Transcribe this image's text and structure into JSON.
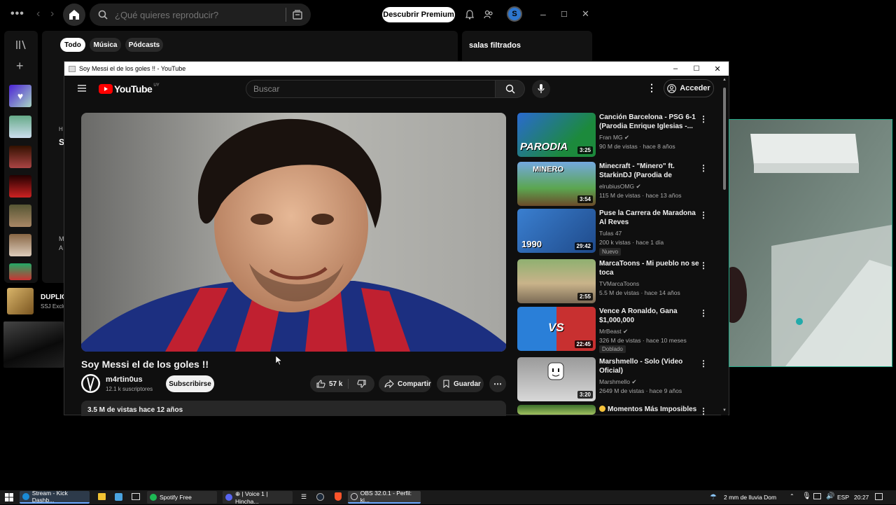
{
  "spotify": {
    "search_placeholder": "¿Qué quieres reproducir?",
    "premium_label": "Descubrir Premium",
    "avatar_letter": "S",
    "chips": [
      "Todo",
      "Música",
      "Pódcasts"
    ],
    "right_panel_title": "salas filtrados",
    "now_playing_title": "DUPLIC",
    "now_playing_artist": "SSJ Exclu",
    "fragments": [
      "H",
      "S",
      "M",
      "A"
    ]
  },
  "youtube": {
    "window_title": "Soy Messi el de los goles !! - YouTube",
    "logo_text": "YouTube",
    "logo_region": "UY",
    "search_placeholder": "Buscar",
    "login_label": "Acceder",
    "video_title": "Soy Messi el de los goles !!",
    "channel_name": "m4rtin0us",
    "subscribers": "12.1 k suscriptores",
    "subscribe_label": "Subscribirse",
    "likes": "57 k",
    "share_label": "Compartir",
    "save_label": "Guardar",
    "views_date": "3.5 M de vistas  hace 12 años",
    "recommendations": [
      {
        "title": "Canción Barcelona - PSG 6-1 (Parodia Enrique Iglesias -...",
        "channel": "Fran MG",
        "verified": true,
        "meta": "90 M de vistas · hace 8 años",
        "duration": "3:25",
        "thumb_text": "PARODIA",
        "badge": ""
      },
      {
        "title": "Minecraft - \"Minero\" ft. StarkinDJ (Parodia de \"Torero\"...",
        "channel": "elrubiusOMG",
        "verified": true,
        "meta": "115 M de vistas · hace 13 años",
        "duration": "3:54",
        "thumb_text": "MINERO",
        "badge": ""
      },
      {
        "title": "Puse la Carrera de Maradona Al Reves",
        "channel": "Tulas 47",
        "verified": false,
        "meta": "200 k vistas · hace 1 día",
        "duration": "29:42",
        "thumb_text": "1990",
        "badge": "Nuevo"
      },
      {
        "title": "MarcaToons - Mi pueblo no se toca",
        "channel": "TVMarcaToons",
        "verified": false,
        "meta": "5.5 M de vistas · hace 14 años",
        "duration": "2:55",
        "thumb_text": "",
        "badge": ""
      },
      {
        "title": "Vence A Ronaldo, Gana $1,000,000",
        "channel": "MrBeast",
        "verified": true,
        "meta": "326 M de vistas · hace 10 meses",
        "duration": "22:45",
        "thumb_text": "VS",
        "badge": "Doblado"
      },
      {
        "title": "Marshmello - Solo (Video Oficial)",
        "channel": "Marshmello",
        "verified": true,
        "meta": "2649 M de vistas · hace 9 años",
        "duration": "3:20",
        "thumb_text": "",
        "badge": ""
      },
      {
        "title": "Momentos Más Imposibles",
        "channel": "",
        "verified": false,
        "meta": "",
        "duration": "",
        "thumb_text": "",
        "badge": ""
      }
    ]
  },
  "taskbar": {
    "items": [
      "Stream - Kick Dashb...",
      "Spotify Free",
      "⊕ | Voice 1 | Hincha...",
      "OBS 32.0.1 - Perfil: ki..."
    ],
    "weather": "2 mm de lluvia Dom",
    "lang": "ESP",
    "time": "20:27"
  }
}
